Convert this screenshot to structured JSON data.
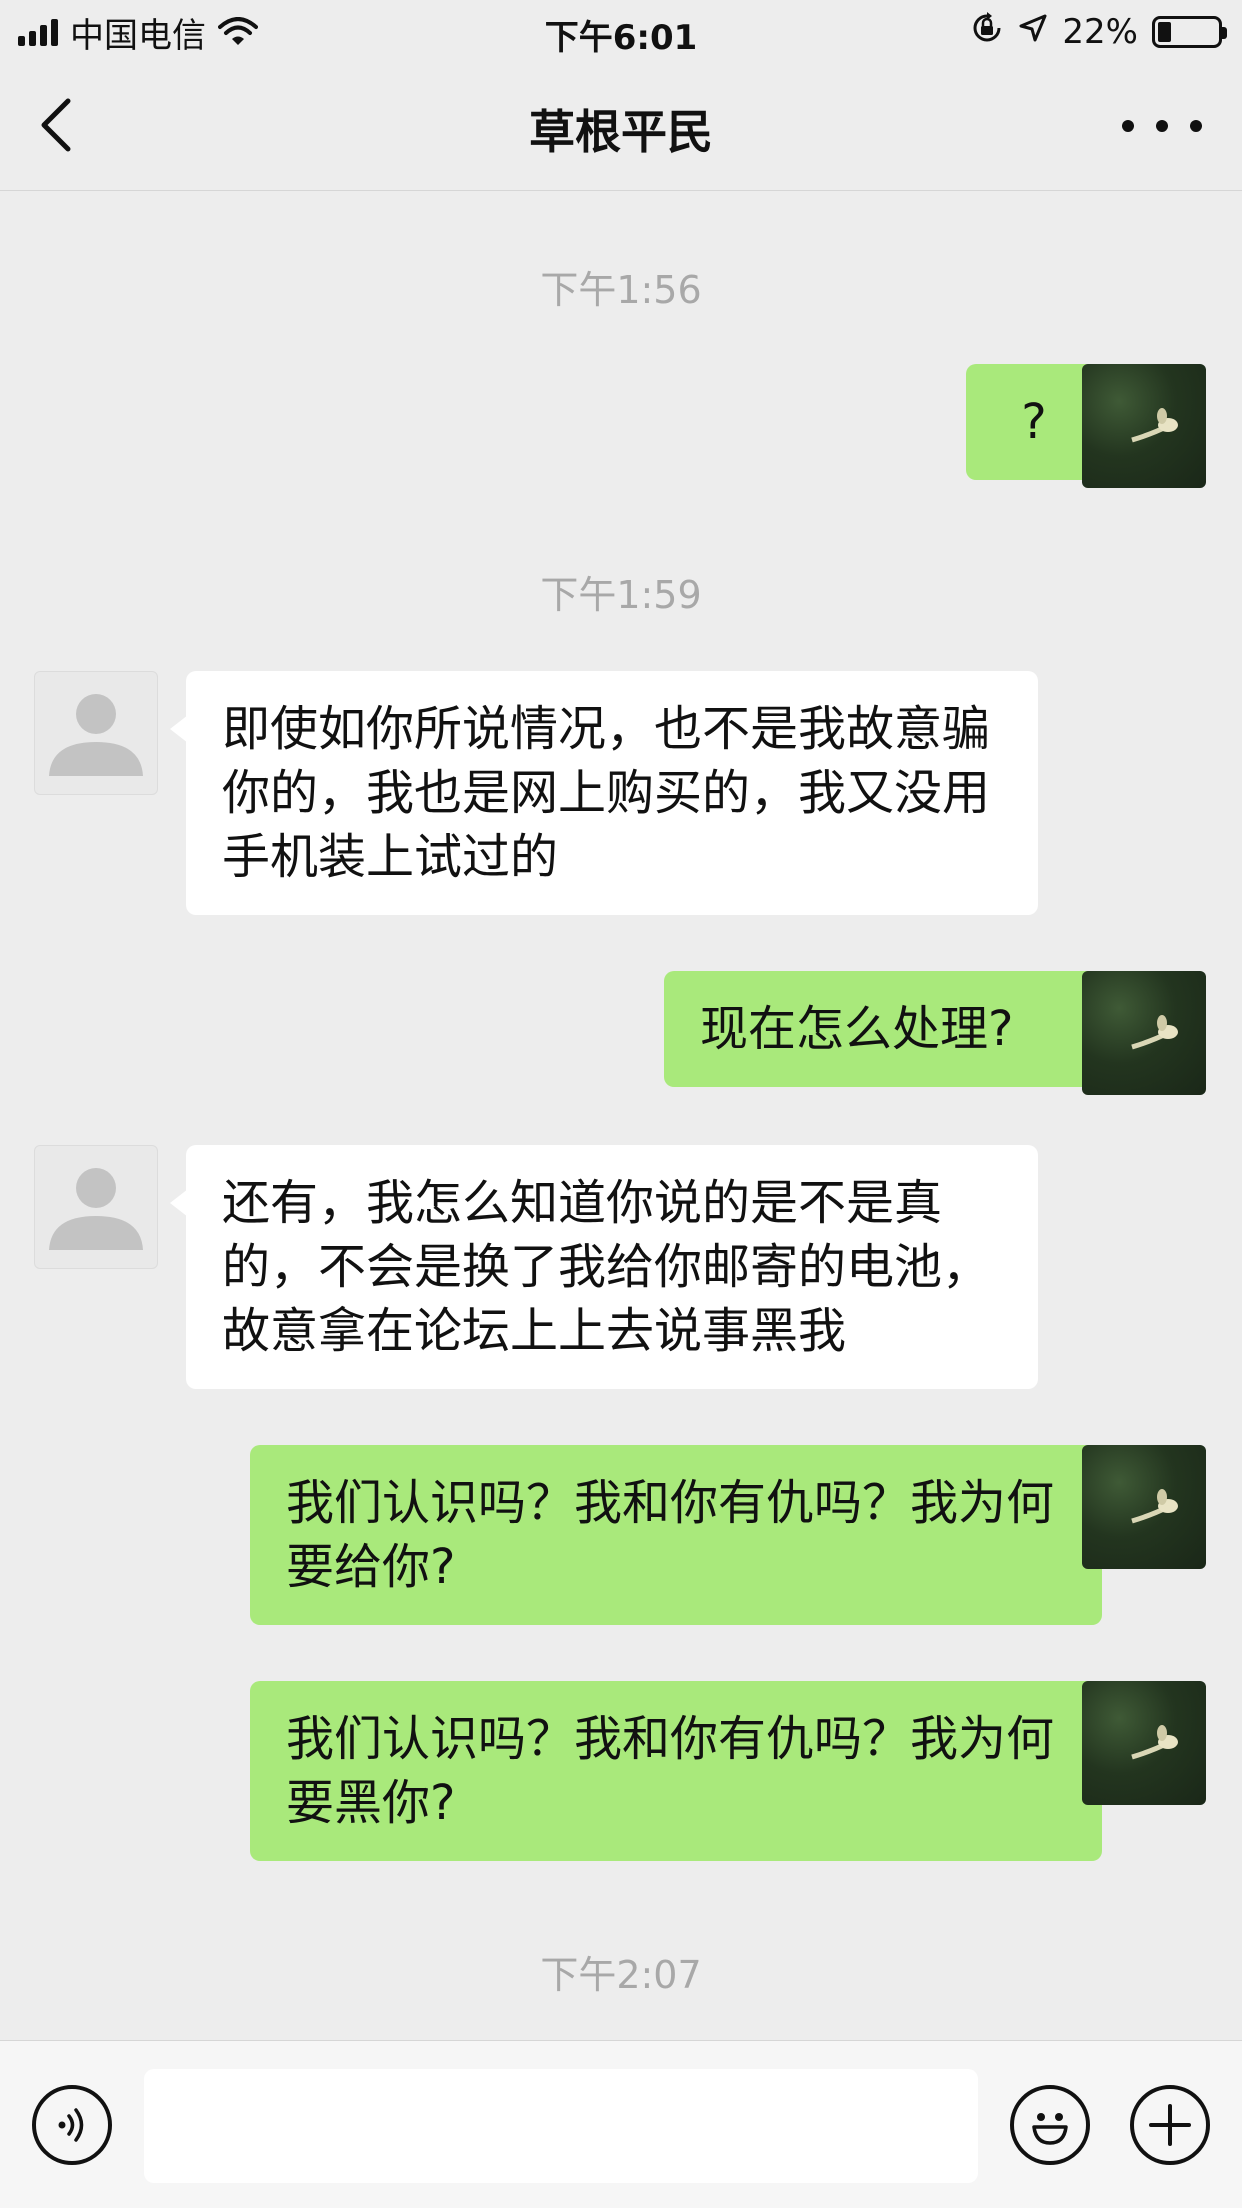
{
  "status_bar": {
    "carrier": "中国电信",
    "time": "下午6:01",
    "battery": "22%"
  },
  "nav": {
    "title": "草根平民"
  },
  "chat": {
    "timestamps": [
      "下午1:56",
      "下午1:59",
      "下午2:07"
    ],
    "messages": [
      {
        "from": "self",
        "text": "?"
      },
      {
        "from": "other",
        "text": "即使如你所说情况，也不是我故意骗你的，我也是网上购买的，我又没用手机装上试过的"
      },
      {
        "from": "self",
        "text": "现在怎么处理?"
      },
      {
        "from": "other",
        "text": "还有，我怎么知道你说的是不是真的，不会是换了我给你邮寄的电池，故意拿在论坛上上去说事黑我"
      },
      {
        "from": "self",
        "text": "我们认识吗？我和你有仇吗？我为何要给你?"
      },
      {
        "from": "self",
        "text": "我们认识吗？我和你有仇吗？我为何要黑你?"
      }
    ]
  },
  "input": {
    "placeholder": ""
  },
  "colors": {
    "self_bubble": "#a9e97b",
    "other_bubble": "#ffffff",
    "background": "#ededed"
  }
}
